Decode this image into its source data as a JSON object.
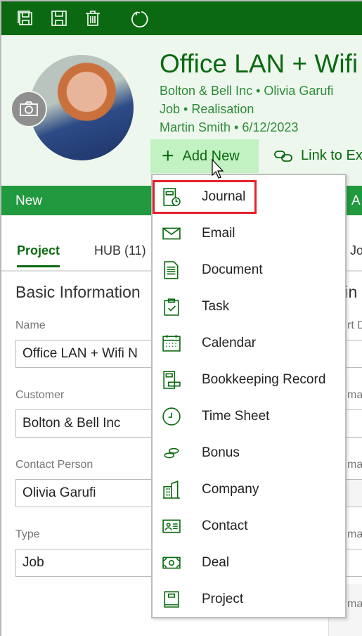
{
  "toolbar": {
    "icons": [
      "save-all-icon",
      "save-icon",
      "delete-icon",
      "refresh-icon"
    ]
  },
  "header": {
    "title": "Office LAN + Wifi",
    "line1": "Bolton & Bell Inc • Olivia Garufi",
    "line2": "Job • Realisation",
    "line3": "Martin Smith • 6/12/2023",
    "add_new": "Add New",
    "link_existing": "Link to Exi"
  },
  "band": {
    "left": "New",
    "right": "A"
  },
  "tabs": [
    {
      "label": "Project",
      "active": true
    },
    {
      "label": "HUB (11)"
    },
    {
      "label": "Jo"
    }
  ],
  "section": {
    "title": "Basic Information",
    "right_title": "tin"
  },
  "fields": [
    {
      "label": "Name",
      "value": "Office LAN + Wifi N"
    },
    {
      "label": "Customer",
      "value": "Bolton & Bell Inc"
    },
    {
      "label": "Contact Person",
      "value": "Olivia Garufi"
    },
    {
      "label": "Type",
      "value": "Job"
    }
  ],
  "right_labels": [
    "rt D",
    "ma",
    "ma",
    "ma",
    "ma"
  ],
  "menu": {
    "items": [
      {
        "label": "Journal",
        "icon": "journal-icon",
        "highlighted": true
      },
      {
        "label": "Email",
        "icon": "email-icon"
      },
      {
        "label": "Document",
        "icon": "document-icon"
      },
      {
        "label": "Task",
        "icon": "task-icon"
      },
      {
        "label": "Calendar",
        "icon": "calendar-icon"
      },
      {
        "label": "Bookkeeping Record",
        "icon": "bookkeeping-icon"
      },
      {
        "label": "Time Sheet",
        "icon": "clock-icon"
      },
      {
        "label": "Bonus",
        "icon": "coins-icon"
      },
      {
        "label": "Company",
        "icon": "building-icon"
      },
      {
        "label": "Contact",
        "icon": "contact-card-icon"
      },
      {
        "label": "Deal",
        "icon": "money-icon"
      },
      {
        "label": "Project",
        "icon": "project-icon"
      }
    ]
  },
  "colors": {
    "topbar": "#0b6a11",
    "band": "#21993f",
    "accent": "#0b6a11",
    "highlight": "#e8202a",
    "add_new_bg": "#c2f2c2"
  }
}
